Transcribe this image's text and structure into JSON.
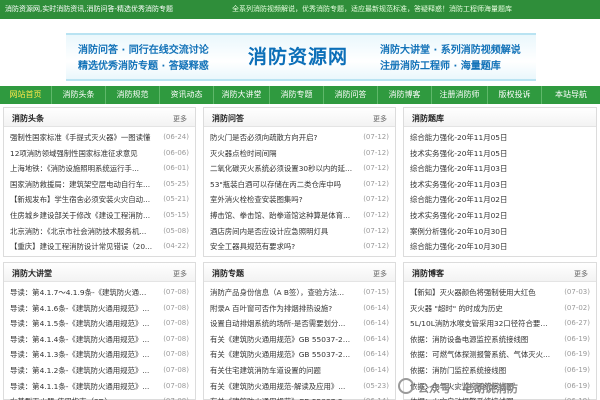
{
  "topbar": {
    "left_text": "消防资源网,实时消防资讯,消防问答-精选优秀消防专题",
    "right_text": "全系列消防视频解说，优秀消防专题，适应最新规范标准，答疑释惑！消防工程师海量题库"
  },
  "banner": {
    "slogan_left_1": "消防问答 · 同行在线交流讨论",
    "slogan_left_2": "精选优秀消防专题 · 答疑释惑",
    "logo": "消防资源网",
    "slogan_right_1": "消防大讲堂 · 系列消防视频解说",
    "slogan_right_2": "注册消防工程师 · 海量题库"
  },
  "nav": {
    "items": [
      "网站首页",
      "消防头条",
      "消防规范",
      "资讯动态",
      "消防大讲堂",
      "消防专题",
      "消防问答",
      "消防博客",
      "注册消防师",
      "版权投诉",
      "本站导航"
    ],
    "active_index": 0
  },
  "panels": {
    "toutiao": {
      "title": "消防头条",
      "more": "更多",
      "rows": [
        {
          "t": "强制性国家标准《手提式灭火器》一图读懂",
          "d": "(06-24)"
        },
        {
          "t": "12项消防领域强制性国家标准征求意见",
          "d": "(06-06)"
        },
        {
          "t": "上海地铁：《消防设施照明系统运行手...",
          "d": "(06-01)"
        },
        {
          "t": "国家消防救援局：建筑架空层电动自行车...",
          "d": "(05-25)"
        },
        {
          "t": "【新规发布】学生宿舍必须安装火灾自动...",
          "d": "(05-21)"
        },
        {
          "t": "住房城乡建设部关于修改《建设工程消防...",
          "d": "(05-15)"
        },
        {
          "t": "北京消防：《北京市社会消防技术服务机...",
          "d": "(05-08)"
        },
        {
          "t": "【重庆】建设工程消防设计常见错误（20...",
          "d": "(04-22)"
        }
      ]
    },
    "wenda": {
      "title": "消防问答",
      "more": "更多",
      "rows": [
        {
          "t": "防火门是否必须向疏散方向开启?",
          "d": "(07-12)"
        },
        {
          "t": "灭火器点检时间间隔",
          "d": "(07-12)"
        },
        {
          "t": "二氧化碳灭火系统必须设置30秒以内的延...",
          "d": "(07-12)"
        },
        {
          "t": "53\"瓶装白酒可以存储在丙二类仓库中吗",
          "d": "(07-12)"
        },
        {
          "t": "室外消火栓检查安装图集吗?",
          "d": "(07-12)"
        },
        {
          "t": "搏击馆、拳击馆、跆拳道馆这种算是体育...",
          "d": "(07-12)"
        },
        {
          "t": "酒店房间内是否应设计应急照明灯具",
          "d": "(07-12)"
        },
        {
          "t": "安全工器具规范有要求吗?",
          "d": "(07-12)"
        }
      ]
    },
    "tiku": {
      "title": "消防题库",
      "more": "",
      "rows": [
        {
          "t": "综合能力强化-20年11月05日",
          "d": ""
        },
        {
          "t": "技术实务强化-20年11月05日",
          "d": ""
        },
        {
          "t": "综合能力强化-20年11月03日",
          "d": ""
        },
        {
          "t": "技术实务强化-20年11月03日",
          "d": ""
        },
        {
          "t": "综合能力强化-20年11月02日",
          "d": ""
        },
        {
          "t": "技术实务强化-20年11月02日",
          "d": ""
        },
        {
          "t": "案例分析强化-20年10月30日",
          "d": ""
        },
        {
          "t": "综合能力强化-20年10月30日",
          "d": ""
        }
      ]
    },
    "jiangtang": {
      "title": "消防大讲堂",
      "more": "更多",
      "rows": [
        {
          "t": "导读：第4.1.7～4.1.9条-《建筑防火通用...",
          "d": "(07-08)"
        },
        {
          "t": "导读：第4.1.6条-《建筑防火通用规范》...",
          "d": "(07-08)"
        },
        {
          "t": "导读：第4.1.5条-《建筑防火通用规范》...",
          "d": "(07-08)"
        },
        {
          "t": "导读：第4.1.4条-《建筑防火通用规范》...",
          "d": "(07-08)"
        },
        {
          "t": "导读：第4.1.3条-《建筑防火通用规范》...",
          "d": "(07-08)"
        },
        {
          "t": "导读：第4.1.2条-《建筑防火通用规范》...",
          "d": "(07-08)"
        },
        {
          "t": "导读：第4.1.1条-《建筑防火通用规范》...",
          "d": "(07-08)"
        },
        {
          "t": "水基型灭火器-使用指南（3D）",
          "d": "(07-08)"
        }
      ]
    },
    "zhuanti": {
      "title": "消防专题",
      "more": "更多",
      "rows": [
        {
          "t": "消防产品身份信息（A B签），查验方法...",
          "d": "(07-15)"
        },
        {
          "t": "附录A 百叶窗可否作为排烟排热设施?",
          "d": "(06-14)"
        },
        {
          "t": "设置自动排烟系统的场所-是否需要划分...",
          "d": "(06-14)"
        },
        {
          "t": "有关《建筑防火通用规范》GB 55037-20...",
          "d": "(06-14)"
        },
        {
          "t": "有关《建筑防火通用规范》GB 55037-20...",
          "d": "(06-14)"
        },
        {
          "t": "有关住宅建筑消防车道设置的问题",
          "d": "(06-14)"
        },
        {
          "t": "有关《建筑防火通用规范-解读及应用》...",
          "d": "(05-23)"
        },
        {
          "t": "有关《建筑防火通用规范》GB 55037-20...",
          "d": "(06-14)"
        }
      ]
    },
    "boke": {
      "title": "消防博客",
      "more": "更多",
      "rows": [
        {
          "t": "【新知】灭火器颜色将强制使用大红色",
          "d": "(07-03)"
        },
        {
          "t": "灭火器 \"超时\" 的时成为历史",
          "d": "(07-02)"
        },
        {
          "t": "5L/10L消防水喉支管采用32口径符合要求...",
          "d": "(06-27)"
        },
        {
          "t": "依据：消防设备电源监控系统接线图",
          "d": "(06-19)"
        },
        {
          "t": "依据：可燃气体探测报警系统、气体灭火...",
          "d": "(06-19)"
        },
        {
          "t": "依据：消防门监控系统接线图",
          "d": "(06-19)"
        },
        {
          "t": "依据：电气火灾监控系统接线图",
          "d": "(06-19)"
        },
        {
          "t": "依据：火灾自动报警系统接线图",
          "d": "(06-19)"
        }
      ]
    }
  },
  "watermark": {
    "text": "公众号 · 老胡说消防"
  },
  "colors": {
    "topbar": "#2f8e3a",
    "nav": "#2f9a3f",
    "nav_active": "#ffe84a",
    "banner_text": "#1272b8"
  }
}
